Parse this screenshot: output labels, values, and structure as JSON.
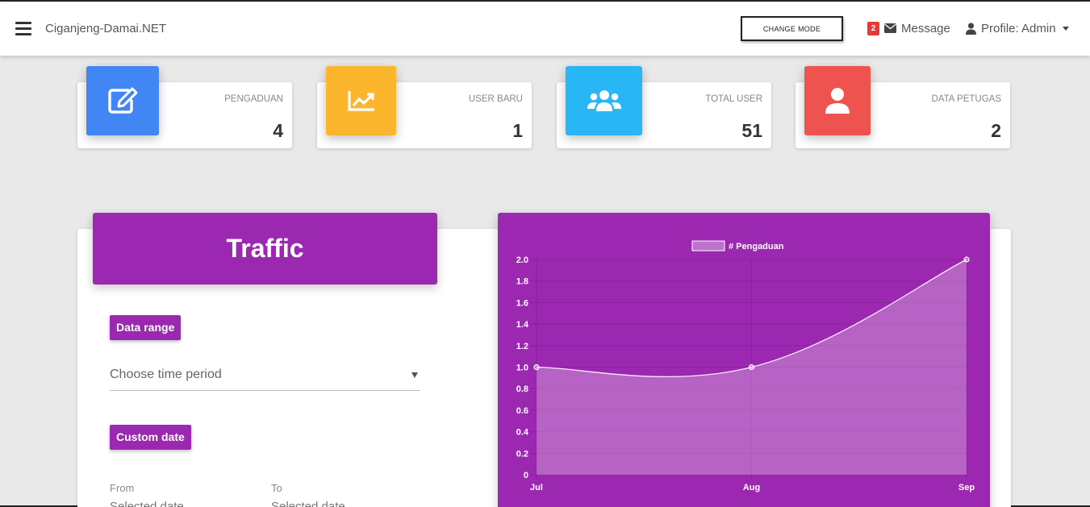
{
  "navbar": {
    "brand": "Ciganjeng-Damai.NET",
    "mode_button": "CHANGE MODE",
    "message_count": "2",
    "message_label": "Message",
    "profile_label": "Profile: Admin"
  },
  "stats": [
    {
      "label": "PENGADUAN",
      "value": "4",
      "color": "#4285f4",
      "icon": "edit-icon"
    },
    {
      "label": "USER BARU",
      "value": "1",
      "color": "#fbb62e",
      "icon": "line-chart-icon"
    },
    {
      "label": "TOTAL USER",
      "value": "51",
      "color": "#29b6f6",
      "icon": "users-icon"
    },
    {
      "label": "DATA PETUGAS",
      "value": "2",
      "color": "#ef5350",
      "icon": "user-icon"
    }
  ],
  "traffic": {
    "title": "Traffic",
    "data_range_label": "Data range",
    "select_value": "Choose time period",
    "custom_date_label": "Custom date",
    "from_label": "From",
    "from_placeholder": "Selected date",
    "to_label": "To",
    "to_placeholder": "Selected date"
  },
  "chart_data": {
    "type": "line",
    "categories": [
      "Jul",
      "Aug",
      "Sep"
    ],
    "series": [
      {
        "name": "# Pengaduan",
        "values": [
          1,
          1,
          2
        ]
      }
    ],
    "ylim": [
      0,
      2
    ],
    "yticks": [
      "0",
      "0.2",
      "0.4",
      "0.6",
      "0.8",
      "1.0",
      "1.2",
      "1.4",
      "1.6",
      "1.8",
      "2.0"
    ],
    "fill": true,
    "legend": "top",
    "grid": true,
    "background": "#9c27b0"
  }
}
